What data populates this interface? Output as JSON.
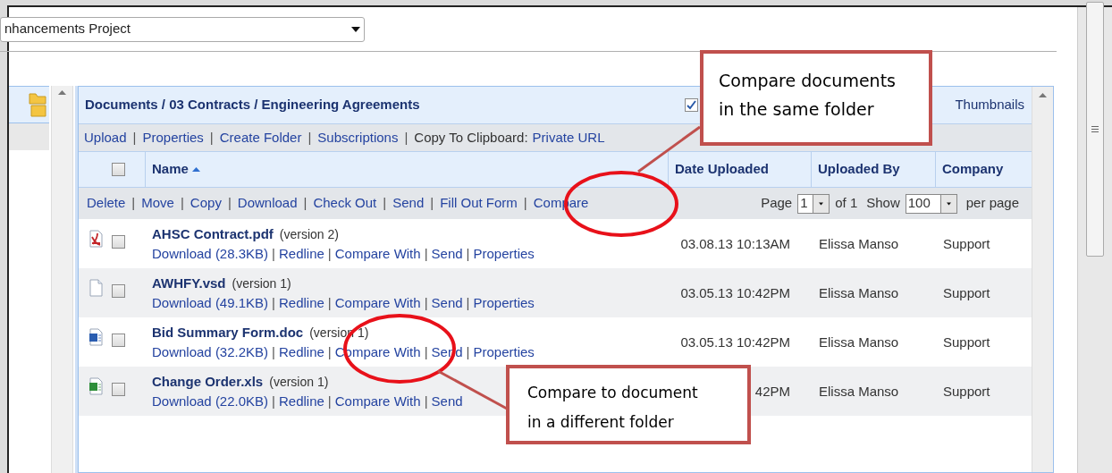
{
  "project_select": {
    "value": "nhancements Project"
  },
  "panel": {
    "title": "Documents / 03 Contracts / Engineering Agreements",
    "thumbnails": {
      "checked": true,
      "label": "Thumbnails"
    }
  },
  "toolbar": [
    {
      "label": "Upload",
      "kind": "link"
    },
    {
      "label": "|",
      "kind": "separator"
    },
    {
      "label": "Properties",
      "kind": "link"
    },
    {
      "label": "|",
      "kind": "separator"
    },
    {
      "label": "Create Folder",
      "kind": "link"
    },
    {
      "label": "|",
      "kind": "separator"
    },
    {
      "label": "Subscriptions",
      "kind": "link"
    },
    {
      "label": "|",
      "kind": "separator"
    },
    {
      "label": "Copy To Clipboard:",
      "kind": "text"
    },
    {
      "label": "Private URL",
      "kind": "link"
    }
  ],
  "table": {
    "select_all": {
      "checked": false
    },
    "columns": [
      {
        "label": "Name",
        "sorted": true
      },
      {
        "label": "Date Uploaded",
        "sorted": false
      },
      {
        "label": "Uploaded By",
        "sorted": false
      },
      {
        "label": "Company",
        "sorted": false
      }
    ],
    "actions": [
      {
        "label": "Delete",
        "kind": "link"
      },
      {
        "label": "|",
        "kind": "separator"
      },
      {
        "label": "Move",
        "kind": "link"
      },
      {
        "label": "|",
        "kind": "separator"
      },
      {
        "label": "Copy",
        "kind": "link"
      },
      {
        "label": "|",
        "kind": "separator"
      },
      {
        "label": "Download",
        "kind": "link"
      },
      {
        "label": "|",
        "kind": "separator"
      },
      {
        "label": "Check Out",
        "kind": "link"
      },
      {
        "label": "|",
        "kind": "separator"
      },
      {
        "label": "Send",
        "kind": "link"
      },
      {
        "label": "|",
        "kind": "separator"
      },
      {
        "label": "Fill Out Form",
        "kind": "link"
      },
      {
        "label": "|",
        "kind": "separator"
      },
      {
        "label": "Compare",
        "kind": "link"
      }
    ],
    "pager": {
      "page_label": "Page",
      "page": "1",
      "of": "of 1",
      "show_label": "Show",
      "show": "100",
      "per_page": "per page"
    },
    "rows": [
      {
        "kind": "pdf",
        "checked": false,
        "name": "AHSC Contract.pdf",
        "version": "(version 2)",
        "links": [
          {
            "label": "Download (28.3KB)",
            "kind": "link"
          },
          {
            "label": "|",
            "kind": "separator"
          },
          {
            "label": "Redline",
            "kind": "link"
          },
          {
            "label": "|",
            "kind": "separator"
          },
          {
            "label": "Compare With",
            "kind": "link"
          },
          {
            "label": "|",
            "kind": "separator"
          },
          {
            "label": "Send",
            "kind": "link"
          },
          {
            "label": "|",
            "kind": "separator"
          },
          {
            "label": "Properties",
            "kind": "link"
          }
        ],
        "date": "03.08.13 10:13AM",
        "uploaded_by": "Elissa Manso",
        "company": "Support"
      },
      {
        "kind": "blank",
        "checked": false,
        "name": "AWHFY.vsd",
        "version": "(version 1)",
        "links": [
          {
            "label": "Download (49.1KB)",
            "kind": "link"
          },
          {
            "label": "|",
            "kind": "separator"
          },
          {
            "label": "Redline",
            "kind": "link"
          },
          {
            "label": "|",
            "kind": "separator"
          },
          {
            "label": "Compare With",
            "kind": "link"
          },
          {
            "label": "|",
            "kind": "separator"
          },
          {
            "label": "Send",
            "kind": "link"
          },
          {
            "label": "|",
            "kind": "separator"
          },
          {
            "label": "Properties",
            "kind": "link"
          }
        ],
        "date": "03.05.13 10:42PM",
        "uploaded_by": "Elissa Manso",
        "company": "Support"
      },
      {
        "kind": "word",
        "checked": false,
        "name": "Bid Summary Form.doc",
        "version": "(version 1)",
        "links": [
          {
            "label": "Download (32.2KB)",
            "kind": "link"
          },
          {
            "label": "|",
            "kind": "separator"
          },
          {
            "label": "Redline",
            "kind": "link"
          },
          {
            "label": "|",
            "kind": "separator"
          },
          {
            "label": "Compare With",
            "kind": "link"
          },
          {
            "label": "|",
            "kind": "separator"
          },
          {
            "label": "Send",
            "kind": "link"
          },
          {
            "label": "|",
            "kind": "separator"
          },
          {
            "label": "Properties",
            "kind": "link"
          }
        ],
        "date": "03.05.13 10:42PM",
        "uploaded_by": "Elissa Manso",
        "company": "Support"
      },
      {
        "kind": "excel",
        "checked": false,
        "name": "Change Order.xls",
        "version": "(version 1)",
        "links": [
          {
            "label": "Download (22.0KB)",
            "kind": "link"
          },
          {
            "label": "|",
            "kind": "separator"
          },
          {
            "label": "Redline",
            "kind": "link"
          },
          {
            "label": "|",
            "kind": "separator"
          },
          {
            "label": "Compare With",
            "kind": "link"
          },
          {
            "label": "|",
            "kind": "separator"
          },
          {
            "label": "Send",
            "kind": "link"
          }
        ],
        "date": "42PM",
        "uploaded_by": "Elissa Manso",
        "company": "Support"
      }
    ]
  },
  "callouts": [
    {
      "text": "Compare documents in the same folder"
    },
    {
      "text": "Compare to document in a different folder"
    }
  ]
}
